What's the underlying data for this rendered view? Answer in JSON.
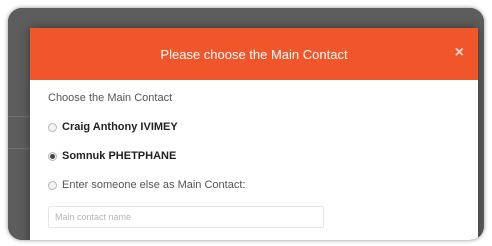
{
  "dialog": {
    "title": "Please choose the Main Contact",
    "close_symbol": "×",
    "prompt": "Choose the Main Contact",
    "options": [
      {
        "label": "Craig Anthony IVIMEY",
        "selected": false
      },
      {
        "label": "Somnuk PHETPHANE",
        "selected": true
      },
      {
        "label": "Enter someone else as Main Contact:",
        "selected": false
      }
    ],
    "other_input": {
      "placeholder": "Main contact name",
      "value": ""
    }
  },
  "colors": {
    "header": "#f0562a",
    "backdrop": "#5d5d5d"
  }
}
